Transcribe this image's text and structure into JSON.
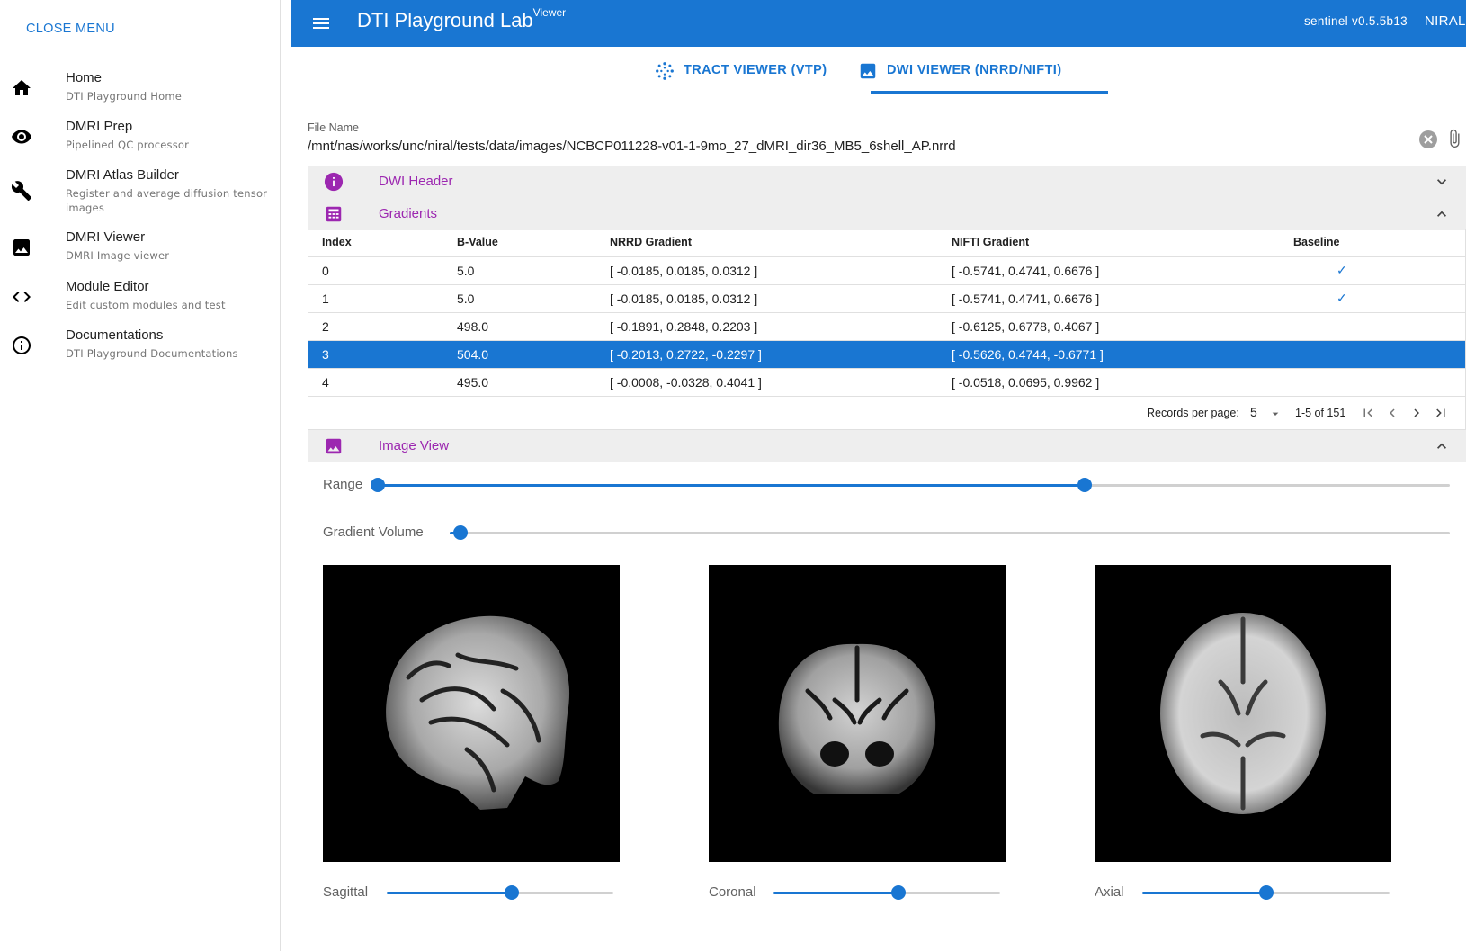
{
  "sidebar": {
    "close_label": "CLOSE MENU",
    "items": [
      {
        "title": "Home",
        "subtitle": "DTI Playground Home",
        "icon": "home-icon"
      },
      {
        "title": "DMRI Prep",
        "subtitle": "Pipelined QC processor",
        "icon": "eye-icon"
      },
      {
        "title": "DMRI Atlas Builder",
        "subtitle": "Register and average diffusion tensor images",
        "icon": "wrench-icon"
      },
      {
        "title": "DMRI Viewer",
        "subtitle": "DMRI Image viewer",
        "icon": "image-icon"
      },
      {
        "title": "Module Editor",
        "subtitle": "Edit custom modules and test",
        "icon": "code-icon"
      },
      {
        "title": "Documentations",
        "subtitle": "DTI Playground Documentations",
        "icon": "info-icon"
      }
    ]
  },
  "header": {
    "title": "DTI Playground Lab",
    "title_sup": "Viewer",
    "version": "sentinel v0.5.5b13",
    "org": "NIRAL"
  },
  "tabs": [
    {
      "label": "TRACT VIEWER (VTP)",
      "icon": "tract-icon",
      "active": false
    },
    {
      "label": "DWI VIEWER (NRRD/NIFTI)",
      "icon": "image-icon",
      "active": true
    }
  ],
  "file": {
    "label": "File Name",
    "value": "/mnt/nas/works/unc/niral/tests/data/images/NCBCP011228-v01-1-9mo_27_dMRI_dir36_MB5_6shell_AP.nrrd"
  },
  "panels": {
    "header": {
      "title": "DWI Header",
      "expanded": false
    },
    "gradients": {
      "title": "Gradients",
      "expanded": true
    },
    "image_view": {
      "title": "Image View",
      "expanded": true
    }
  },
  "table": {
    "columns": [
      "Index",
      "B-Value",
      "NRRD Gradient",
      "NIFTI Gradient",
      "Baseline"
    ],
    "rows": [
      {
        "index": "0",
        "bvalue": "5.0",
        "nrrd": "[ -0.0185, 0.0185, 0.0312 ]",
        "nifti": "[ -0.5741, 0.4741, 0.6676 ]",
        "baseline": "✓",
        "selected": false
      },
      {
        "index": "1",
        "bvalue": "5.0",
        "nrrd": "[ -0.0185, 0.0185, 0.0312 ]",
        "nifti": "[ -0.5741, 0.4741, 0.6676 ]",
        "baseline": "✓",
        "selected": false
      },
      {
        "index": "2",
        "bvalue": "498.0",
        "nrrd": "[ -0.1891, 0.2848, 0.2203 ]",
        "nifti": "[ -0.6125, 0.6778, 0.4067 ]",
        "baseline": "",
        "selected": false
      },
      {
        "index": "3",
        "bvalue": "504.0",
        "nrrd": "[ -0.2013, 0.2722, -0.2297 ]",
        "nifti": "[ -0.5626, 0.4744, -0.6771 ]",
        "baseline": "",
        "selected": true
      },
      {
        "index": "4",
        "bvalue": "495.0",
        "nrrd": "[ -0.0008, -0.0328, 0.4041 ]",
        "nifti": "[ -0.0518, 0.0695, 0.9962 ]",
        "baseline": "",
        "selected": false
      }
    ],
    "footer": {
      "rpp_label": "Records per page:",
      "rpp_value": "5",
      "range": "1-5 of 151"
    }
  },
  "image_view": {
    "range": {
      "label": "Range",
      "low": 0.0,
      "high": 0.6596
    },
    "gradient_volume": {
      "label": "Gradient Volume",
      "value": 0.0
    },
    "views": [
      {
        "label": "Sagittal",
        "slider": 0.55
      },
      {
        "label": "Coronal",
        "slider": 0.55
      },
      {
        "label": "Axial",
        "slider": 0.5
      }
    ]
  },
  "colors": {
    "primary": "#1976d2",
    "panel_title": "#9c27b0",
    "panel_bg": "#eeeeee"
  }
}
